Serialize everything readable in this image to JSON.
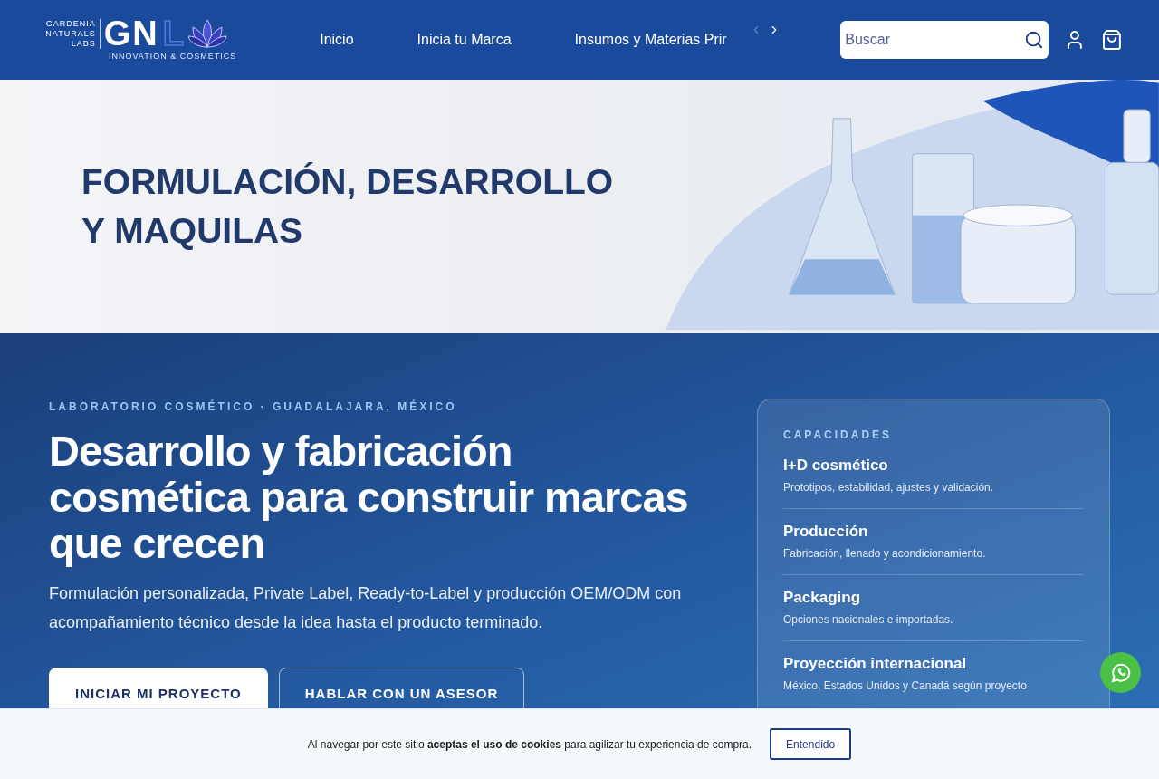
{
  "header": {
    "logo": {
      "wordmark_lines": [
        "GARDENIA",
        "NATURALS",
        "LABS"
      ],
      "letters": "GN",
      "accent_letter": "L",
      "tagline": "INNOVATION & COSMETICS"
    },
    "nav": [
      {
        "label": "Inicio"
      },
      {
        "label": "Inicia tu Marca"
      },
      {
        "label": "Insumos y Materias Prir"
      }
    ],
    "nav_arrows": [
      {
        "kind": "previous",
        "disabled": true
      },
      {
        "kind": "next",
        "disabled": false
      }
    ],
    "search": {
      "placeholder": "Buscar"
    }
  },
  "banner": {
    "title_lines": [
      "FORMULACIÓN, DESARROLLO",
      "Y MAQUILAS"
    ]
  },
  "intro": {
    "eyebrow": "LABORATORIO COSMÉTICO · GUADALAJARA, MÉXICO",
    "heading": "Desarrollo y fabricación cosmética para construir marcas que crecen",
    "body": "Formulación personalizada, Private Label, Ready-to-Label y producción OEM/ODM con acompañamiento técnico desde la idea hasta el producto terminado.",
    "buttons": [
      {
        "label": "INICIAR MI PROYECTO",
        "kind": "primary"
      },
      {
        "label": "HABLAR CON UN ASESOR",
        "kind": "outline"
      }
    ]
  },
  "capabilities": {
    "title": "CAPACIDADES",
    "items": [
      {
        "title": "I+D cosmético",
        "text": "Prototipos, estabilidad, ajustes y validación."
      },
      {
        "title": "Producción",
        "text": "Fabricación, llenado y acondicionamiento."
      },
      {
        "title": "Packaging",
        "text": "Opciones nacionales e importadas."
      },
      {
        "title": "Proyección internacional",
        "text": "México, Estados Unidos y Canadá según proyecto"
      }
    ]
  },
  "cookie_bar": {
    "message": "Al navegar por este sitio **aceptas el uso de cookies** para agilizar tu experiencia de compra.",
    "button": "Entendido"
  }
}
